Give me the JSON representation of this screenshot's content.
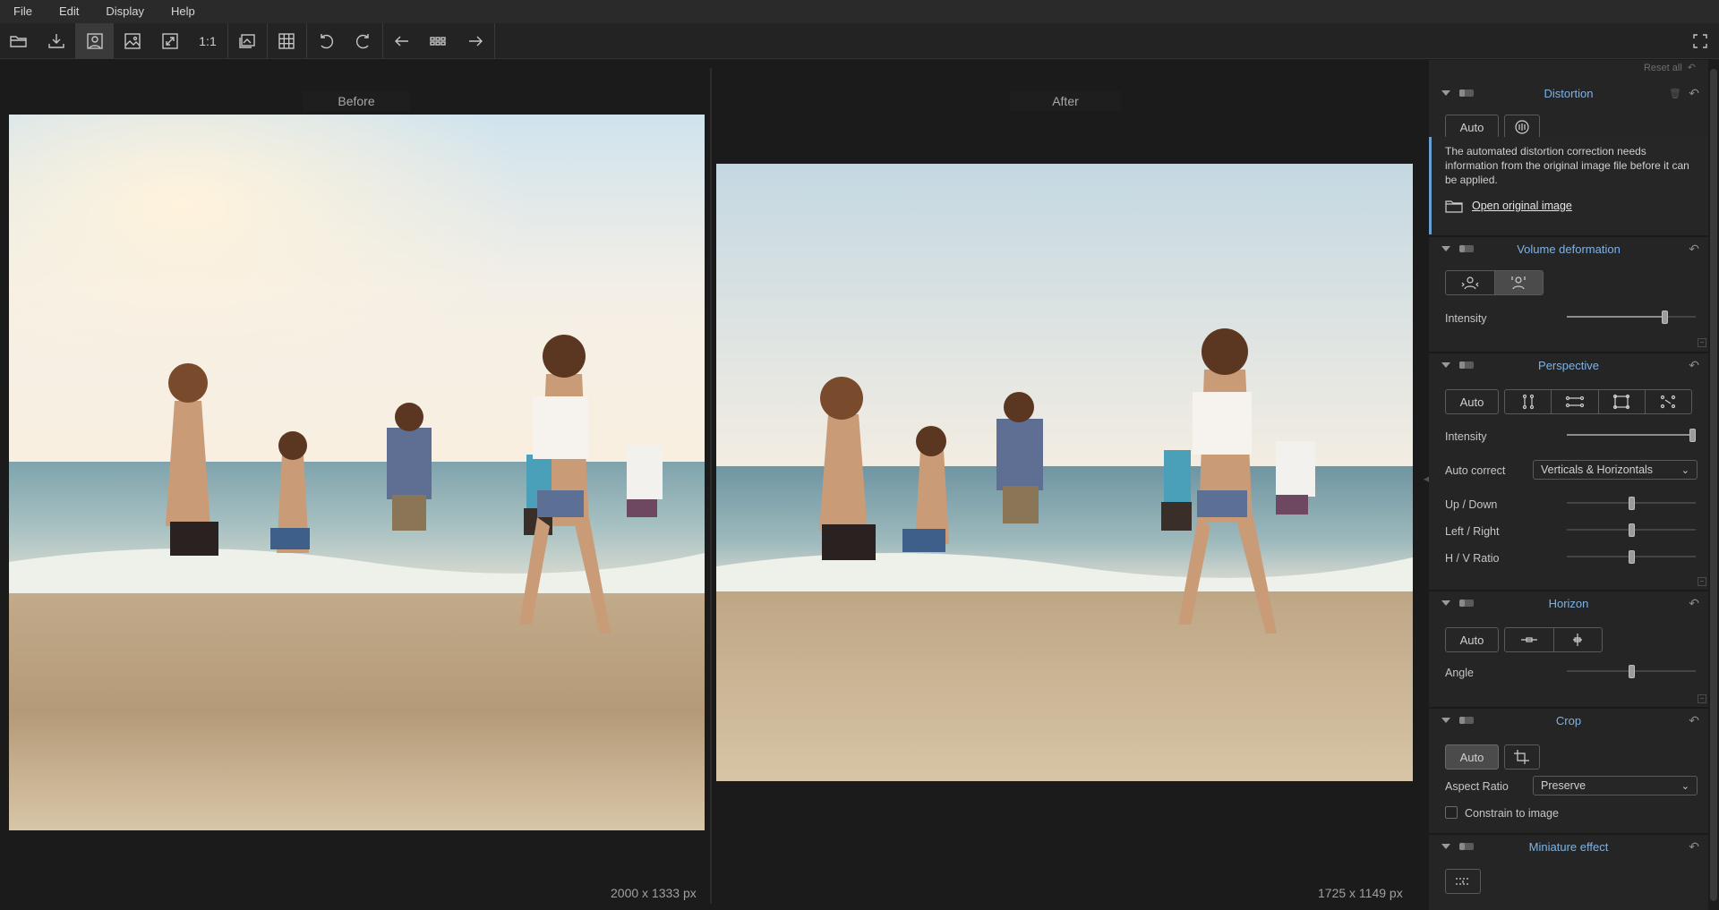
{
  "menu": [
    "File",
    "Edit",
    "Display",
    "Help"
  ],
  "toolbar": {
    "icons": [
      "open-folder-icon",
      "export-icon",
      "single-view-icon",
      "image-icon",
      "fit-icon",
      "one-to-one-icon",
      "compare-icon",
      "grid-icon",
      "rotate-left-icon",
      "rotate-right-icon",
      "previous-icon",
      "thumbnails-icon",
      "next-icon",
      "fullscreen-icon"
    ],
    "one_to_one_label": "1:1",
    "active": "single-view-icon"
  },
  "viewer": {
    "before_label": "Before",
    "after_label": "After",
    "before_dims": "2000 x 1333 px",
    "after_dims": "1725 x 1149 px"
  },
  "panel": {
    "reset_all": "Reset all",
    "distortion": {
      "title": "Distortion",
      "auto": "Auto",
      "info_text": "The automated distortion correction needs information from the original image file before it can be applied.",
      "open_original": "Open original image"
    },
    "volume": {
      "title": "Volume deformation",
      "intensity_label": "Intensity",
      "intensity": 0.76,
      "selected_mode": 1
    },
    "perspective": {
      "title": "Perspective",
      "auto": "Auto",
      "intensity_label": "Intensity",
      "intensity": 1.0,
      "auto_correct_label": "Auto correct",
      "auto_correct_value": "Verticals & Horizontals",
      "up_down_label": "Up / Down",
      "up_down": 0.5,
      "left_right_label": "Left / Right",
      "left_right": 0.5,
      "hv_ratio_label": "H / V Ratio",
      "hv_ratio": 0.5
    },
    "horizon": {
      "title": "Horizon",
      "auto": "Auto",
      "angle_label": "Angle",
      "angle": 0.5
    },
    "crop": {
      "title": "Crop",
      "auto": "Auto",
      "aspect_label": "Aspect Ratio",
      "aspect_value": "Preserve",
      "constrain_label": "Constrain to image",
      "constrain_checked": false
    },
    "miniature": {
      "title": "Miniature effect"
    }
  },
  "colors": {
    "accent": "#7fb2e4",
    "info_bar": "#6b9fd1",
    "panel_bg": "#252525",
    "viewer_bg": "#1b1b1b"
  }
}
